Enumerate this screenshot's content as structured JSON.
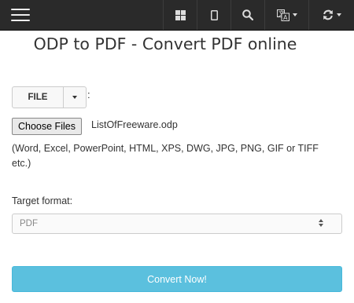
{
  "navbar": {
    "icons": [
      "hamburger-menu-icon",
      "grid-icon",
      "tablet-icon",
      "search-icon",
      "language-icon",
      "refresh-icon"
    ]
  },
  "page": {
    "title": "ODP to PDF - Convert PDF online"
  },
  "file_source": {
    "button_label": "FILE",
    "colon": ":",
    "choose_label": "Choose Files",
    "file_name": "ListOfFreeware.odp",
    "hint": "(Word, Excel, PowerPoint, HTML, XPS, DWG, JPG, PNG, GIF or TIFF etc.)"
  },
  "target": {
    "label": "Target format:",
    "selected": "PDF"
  },
  "actions": {
    "convert_label": "Convert Now!"
  },
  "colors": {
    "navbar": "#2a2a2a",
    "primary_button": "#5bc0de"
  }
}
